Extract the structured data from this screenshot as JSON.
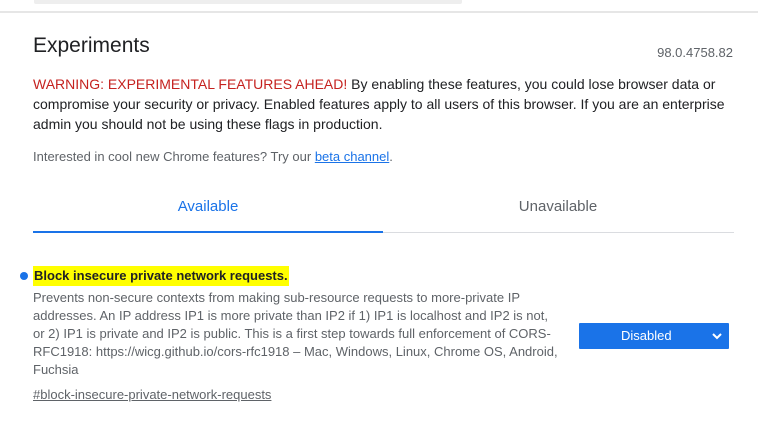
{
  "header": {
    "title": "Experiments",
    "version": "98.0.4758.82"
  },
  "warning": {
    "lead": "WARNING: EXPERIMENTAL FEATURES AHEAD!",
    "body": " By enabling these features, you could lose browser data or compromise your security or privacy. Enabled features apply to all users of this browser. If you are an enterprise admin you should not be using these flags in production."
  },
  "intro": {
    "text": "Interested in cool new Chrome features? Try our ",
    "link_label": "beta channel",
    "trailing": "."
  },
  "tabs": [
    {
      "label": "Available",
      "selected": true
    },
    {
      "label": "Unavailable",
      "selected": false
    }
  ],
  "experiment": {
    "name": "Block insecure private network requests.",
    "description": "Prevents non-secure contexts from making sub-resource requests to more-private IP addresses. An IP address IP1 is more private than IP2 if 1) IP1 is localhost and IP2 is not, or 2) IP1 is private and IP2 is public. This is a first step towards full enforcement of CORS-RFC1918: https://wicg.github.io/cors-rfc1918 – Mac, Windows, Linux, Chrome OS, Android, Fuchsia",
    "link": "#block-insecure-private-network-requests",
    "selected_option": "Disabled",
    "modified": true
  },
  "colors": {
    "accent": "#1a73e8",
    "warning": "#c5221f",
    "highlight": "#ffff00"
  },
  "icons": {
    "select_chevron": "chevron-down-icon",
    "modified_indicator": "dot-icon"
  }
}
